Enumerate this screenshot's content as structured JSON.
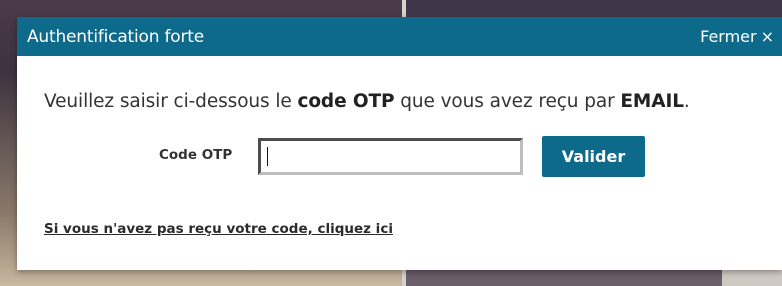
{
  "dialog": {
    "title": "Authentification forte",
    "close_label": "Fermer",
    "close_symbol": "×",
    "message": {
      "part1": "Veuillez saisir ci-dessous le ",
      "bold1": "code OTP",
      "part2": " que vous avez reçu par ",
      "bold2": "EMAIL",
      "part3": "."
    },
    "otp": {
      "label": "Code OTP",
      "value": "",
      "placeholder": ""
    },
    "validate_label": "Valider",
    "resend_link": "Si vous n'avez pas reçu votre code, cliquez ici"
  },
  "colors": {
    "accent": "#0d6a8a",
    "text": "#333333",
    "background": "#ffffff"
  }
}
